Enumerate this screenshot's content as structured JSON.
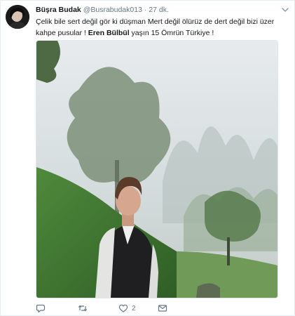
{
  "tweet": {
    "author_name": "Büşra Budak",
    "author_handle": "@Busrabudak013",
    "separator": "·",
    "timestamp": "27 dk.",
    "text_part1": "Çelik bile sert değil gör ki düşman Mert değil ölürüz de dert değil bizi üzer kahpe pusular ! ",
    "text_bold": "Eren Bülbül",
    "text_part2": " yaşın 15 Ömrün Türkiye !",
    "reply_count": "",
    "retweet_count": "",
    "like_count": "2"
  },
  "icons": {
    "avatar": "avatar",
    "chevron": "chevron-down-icon",
    "reply": "reply-icon",
    "retweet": "retweet-icon",
    "like": "heart-icon",
    "dm": "envelope-icon"
  },
  "colors": {
    "text": "#14171a",
    "secondary": "#657786",
    "border": "#e6ecf0"
  }
}
